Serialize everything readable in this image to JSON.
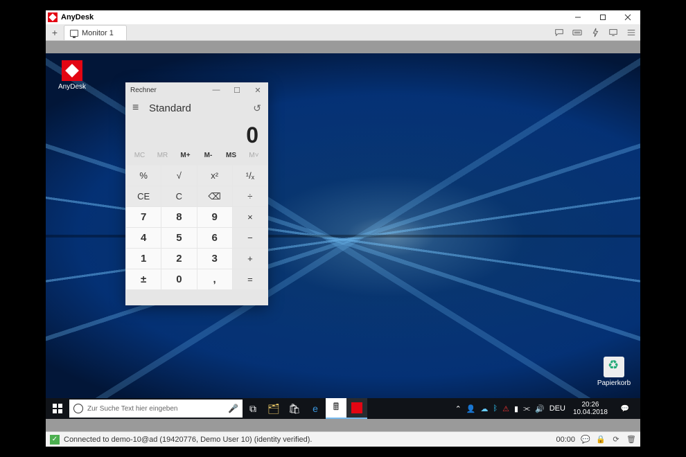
{
  "anydesk": {
    "app_title": "AnyDesk",
    "tab_label": "Monitor 1",
    "status_text": "Connected to demo-10@ad (19420776, Demo User 10) (identity verified).",
    "session_time": "00:00"
  },
  "desktop_icons": {
    "anydesk": "AnyDesk",
    "recycle": "Papierkorb"
  },
  "calculator": {
    "window_title": "Rechner",
    "mode": "Standard",
    "display": "0",
    "mem": [
      "MC",
      "MR",
      "M+",
      "M-",
      "MS",
      "M˅"
    ],
    "buttons": [
      {
        "l": "%",
        "c": "fn"
      },
      {
        "l": "√",
        "c": "fn"
      },
      {
        "l": "x²",
        "c": "fn"
      },
      {
        "l": "¹/ₓ",
        "c": "fn"
      },
      {
        "l": "CE",
        "c": "fn"
      },
      {
        "l": "C",
        "c": "fn"
      },
      {
        "l": "⌫",
        "c": "fn"
      },
      {
        "l": "÷",
        "c": "fn"
      },
      {
        "l": "7",
        "c": "num"
      },
      {
        "l": "8",
        "c": "num"
      },
      {
        "l": "9",
        "c": "num"
      },
      {
        "l": "×",
        "c": "fn"
      },
      {
        "l": "4",
        "c": "num"
      },
      {
        "l": "5",
        "c": "num"
      },
      {
        "l": "6",
        "c": "num"
      },
      {
        "l": "−",
        "c": "fn"
      },
      {
        "l": "1",
        "c": "num"
      },
      {
        "l": "2",
        "c": "num"
      },
      {
        "l": "3",
        "c": "num"
      },
      {
        "l": "+",
        "c": "fn"
      },
      {
        "l": "±",
        "c": "num"
      },
      {
        "l": "0",
        "c": "num"
      },
      {
        "l": ",",
        "c": "num"
      },
      {
        "l": "=",
        "c": "fn"
      }
    ]
  },
  "taskbar": {
    "search_placeholder": "Zur Suche Text hier eingeben",
    "lang": "DEU",
    "time": "20:26",
    "date": "10.04.2018"
  }
}
